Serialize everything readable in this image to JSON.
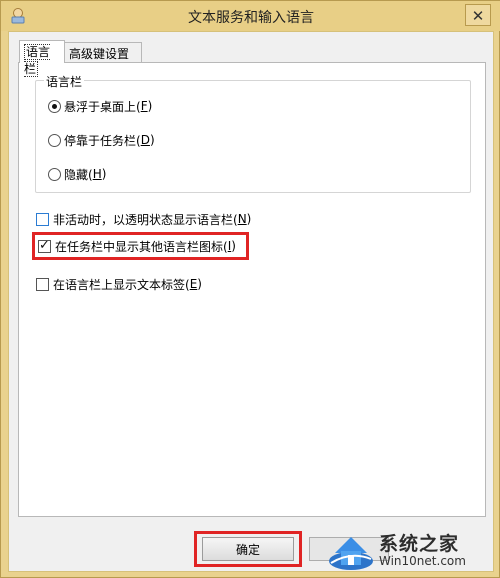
{
  "window": {
    "title": "文本服务和输入语言",
    "close_glyph": "✕",
    "chrome_color": "#e8cf86"
  },
  "tabs": [
    {
      "label": "语言栏",
      "active": true
    },
    {
      "label": "高级键设置",
      "active": false
    }
  ],
  "language_bar_group": {
    "legend": "语言栏",
    "options": [
      {
        "text": "悬浮于桌面上(",
        "key": "F",
        "suffix": ")",
        "selected": true
      },
      {
        "text": "停靠于任务栏(",
        "key": "D",
        "suffix": ")",
        "selected": false
      },
      {
        "text": "隐藏(",
        "key": "H",
        "suffix": ")",
        "selected": false
      }
    ]
  },
  "checkboxes": [
    {
      "text": "非活动时，以透明状态显示语言栏(",
      "key": "N",
      "suffix": ")",
      "checked": false
    },
    {
      "text": "在任务栏中显示其他语言栏图标(",
      "key": "I",
      "suffix": ")",
      "checked": true
    },
    {
      "text": "在语言栏上显示文本标签(",
      "key": "E",
      "suffix": ")",
      "checked": false
    }
  ],
  "buttons": {
    "ok_label": "确定"
  },
  "watermark": {
    "brand": "系统之家",
    "url": "Win10net.com"
  },
  "colors": {
    "highlight": "#e02424",
    "focus_checkbox": "#2b7cd3"
  }
}
